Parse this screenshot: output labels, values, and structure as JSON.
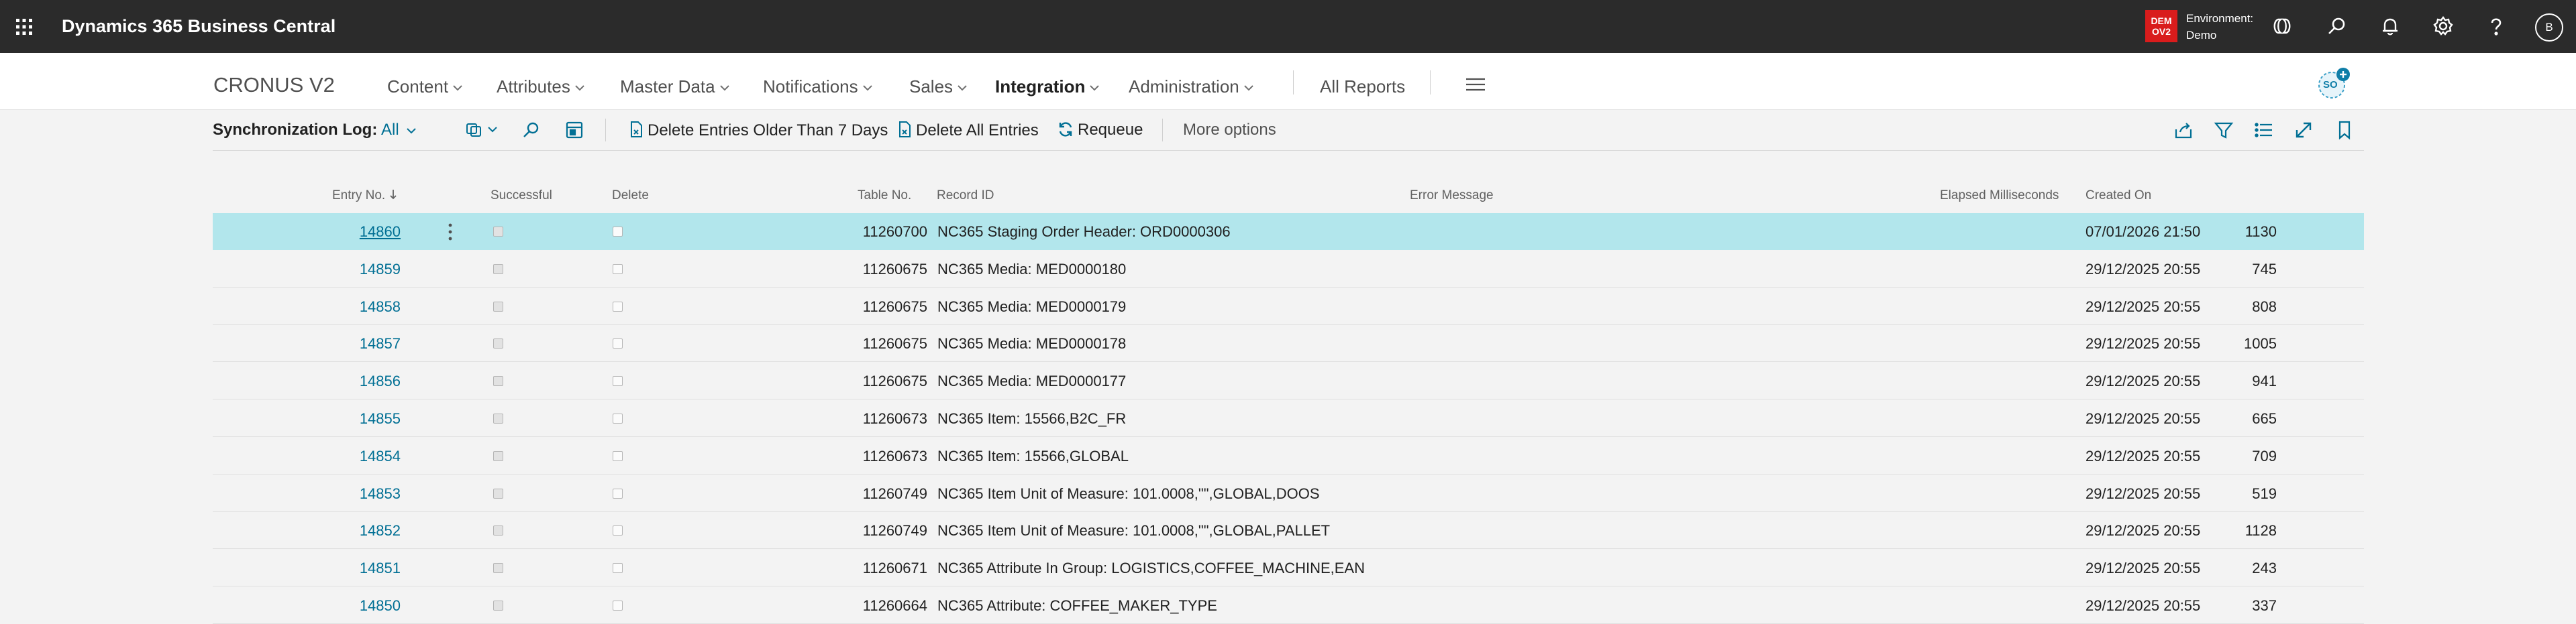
{
  "app": {
    "title": "Dynamics 365 Business Central",
    "env_badge_line1": "DEM",
    "env_badge_line2": "OV2",
    "env_label": "Environment:",
    "env_name": "Demo",
    "user_initial": "B",
    "copilot_label": "SO"
  },
  "nav": {
    "company": "CRONUS V2",
    "items": [
      "Content",
      "Attributes",
      "Master Data",
      "Notifications",
      "Sales",
      "Integration",
      "Administration"
    ],
    "all_reports": "All Reports"
  },
  "actions": {
    "page_title": "Synchronization Log:",
    "filter_label": "All",
    "delete_older": "Delete Entries Older Than 7 Days",
    "delete_all": "Delete All Entries",
    "requeue": "Requeue",
    "more_options": "More options"
  },
  "table": {
    "columns": {
      "entry_no": "Entry No.",
      "successful": "Successful",
      "delete": "Delete",
      "table_no": "Table No.",
      "record_id": "Record ID",
      "error_message": "Error Message",
      "elapsed": "Elapsed Milliseconds",
      "created_on": "Created On"
    },
    "rows": [
      {
        "entry_no": "14860",
        "successful": true,
        "delete": false,
        "table_no": "11260700",
        "record_id": "NC365 Staging Order Header: ORD0000306",
        "error": "",
        "elapsed": "1130",
        "created_on": "07/01/2026 21:50"
      },
      {
        "entry_no": "14859",
        "successful": true,
        "delete": false,
        "table_no": "11260675",
        "record_id": "NC365 Media: MED0000180",
        "error": "",
        "elapsed": "745",
        "created_on": "29/12/2025 20:55"
      },
      {
        "entry_no": "14858",
        "successful": true,
        "delete": false,
        "table_no": "11260675",
        "record_id": "NC365 Media: MED0000179",
        "error": "",
        "elapsed": "808",
        "created_on": "29/12/2025 20:55"
      },
      {
        "entry_no": "14857",
        "successful": true,
        "delete": false,
        "table_no": "11260675",
        "record_id": "NC365 Media: MED0000178",
        "error": "",
        "elapsed": "1005",
        "created_on": "29/12/2025 20:55"
      },
      {
        "entry_no": "14856",
        "successful": true,
        "delete": false,
        "table_no": "11260675",
        "record_id": "NC365 Media: MED0000177",
        "error": "",
        "elapsed": "941",
        "created_on": "29/12/2025 20:55"
      },
      {
        "entry_no": "14855",
        "successful": true,
        "delete": false,
        "table_no": "11260673",
        "record_id": "NC365 Item: 15566,B2C_FR",
        "error": "",
        "elapsed": "665",
        "created_on": "29/12/2025 20:55"
      },
      {
        "entry_no": "14854",
        "successful": true,
        "delete": false,
        "table_no": "11260673",
        "record_id": "NC365 Item: 15566,GLOBAL",
        "error": "",
        "elapsed": "709",
        "created_on": "29/12/2025 20:55"
      },
      {
        "entry_no": "14853",
        "successful": true,
        "delete": false,
        "table_no": "11260749",
        "record_id": "NC365 Item Unit of Measure: 101.0008,\"\",GLOBAL,DOOS",
        "error": "",
        "elapsed": "519",
        "created_on": "29/12/2025 20:55"
      },
      {
        "entry_no": "14852",
        "successful": true,
        "delete": false,
        "table_no": "11260749",
        "record_id": "NC365 Item Unit of Measure: 101.0008,\"\",GLOBAL,PALLET",
        "error": "",
        "elapsed": "1128",
        "created_on": "29/12/2025 20:55"
      },
      {
        "entry_no": "14851",
        "successful": true,
        "delete": false,
        "table_no": "11260671",
        "record_id": "NC365 Attribute In Group: LOGISTICS,COFFEE_MACHINE,EAN",
        "error": "",
        "elapsed": "243",
        "created_on": "29/12/2025 20:55"
      },
      {
        "entry_no": "14850",
        "successful": true,
        "delete": false,
        "table_no": "11260664",
        "record_id": "NC365 Attribute: COFFEE_MAKER_TYPE",
        "error": "",
        "elapsed": "337",
        "created_on": "29/12/2025 20:55"
      }
    ]
  },
  "colors": {
    "topbar": "#2b2b2b",
    "accent": "#006f94",
    "selected_row": "#b2e6ec",
    "env_badge": "#d91c1c"
  }
}
